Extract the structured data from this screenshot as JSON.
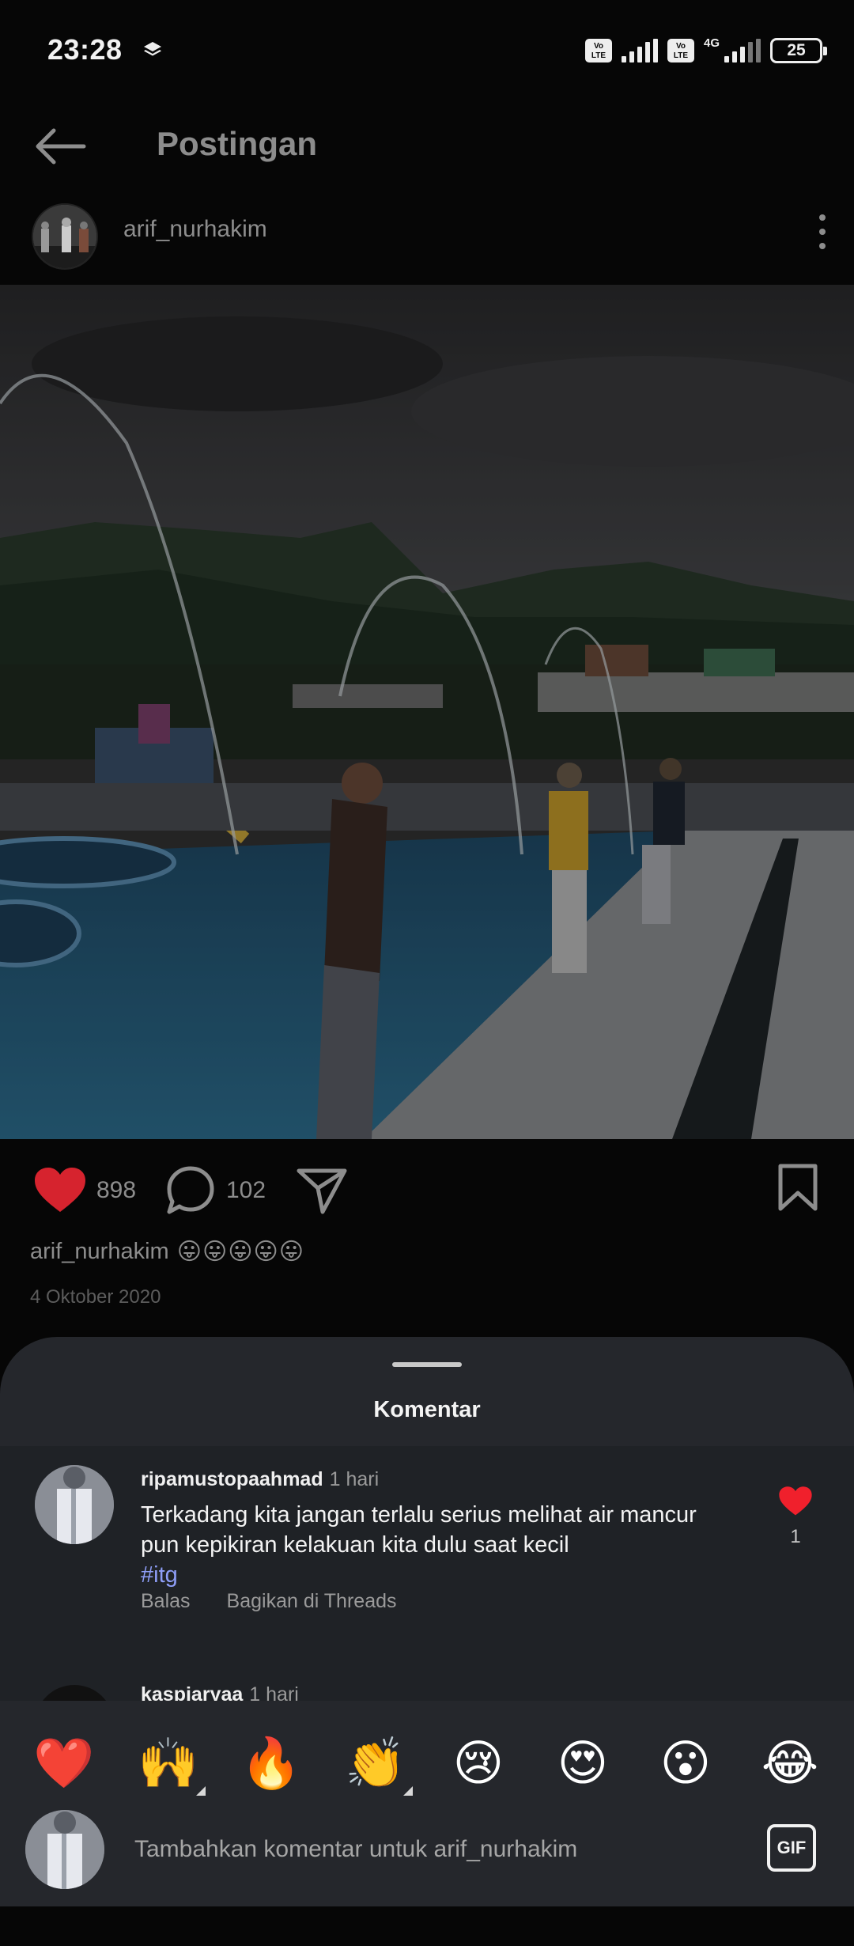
{
  "status_bar": {
    "time": "23:28",
    "network": "4G",
    "volte": "Vo LTE",
    "battery": "25",
    "icons": [
      "layers-icon",
      "volte-icon",
      "signal-icon",
      "battery-icon"
    ]
  },
  "header": {
    "title": "Postingan",
    "back_icon": "arrow-left-icon"
  },
  "post": {
    "username": "arif_nurhakim",
    "likes": "898",
    "comments": "102",
    "caption_user": "arif_nurhakim",
    "caption_emoji": "😛😛😛😛😛",
    "date": "4 Oktober 2020",
    "icons": [
      "heart-icon",
      "comment-icon",
      "share-icon",
      "bookmark-icon",
      "more-icon"
    ]
  },
  "sheet": {
    "title": "Komentar",
    "comments": [
      {
        "user": "ripamustopaahmad",
        "time": "1 hari",
        "text": "Terkadang kita jangan terlalu serius melihat air mancur pun kepikiran kelakuan kita dulu saat kecil",
        "tag": "#itg",
        "reply": "Balas",
        "share": "Bagikan di Threads",
        "likes": "1"
      },
      {
        "user": "kaspiaryaa",
        "time": "1 hari"
      }
    ]
  },
  "emoji_bar": [
    "❤️",
    "🙌",
    "🔥",
    "👏",
    "😢",
    "😍",
    "😮",
    "😂"
  ],
  "composer": {
    "placeholder": "Tambahkan komentar untuk arif_nurhakim",
    "gif_label": "GIF"
  },
  "colors": {
    "background": "#060606",
    "sheet": "#25272c",
    "like_red": "#e0202a",
    "hashtag": "#8e9ef7"
  }
}
